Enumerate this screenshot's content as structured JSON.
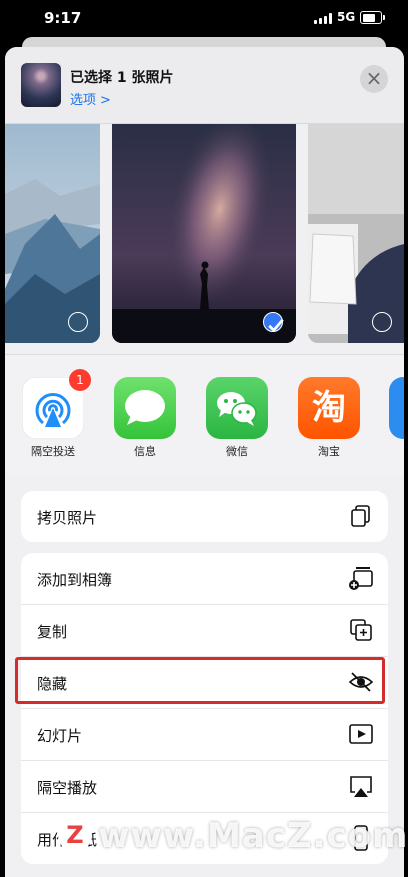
{
  "status_bar": {
    "time": "9:17",
    "network": "5G"
  },
  "header": {
    "title": "已选择 1 张照片",
    "options_label": "选项",
    "options_chevron": ">",
    "close_glyph": "×"
  },
  "apps": [
    {
      "label": "隔空投送",
      "badge": "1",
      "icon": "airdrop-icon"
    },
    {
      "label": "信息",
      "icon": "messages-icon"
    },
    {
      "label": "微信",
      "icon": "wechat-icon"
    },
    {
      "label": "淘宝",
      "icon": "taobao-icon",
      "glyph": "淘"
    }
  ],
  "actions": {
    "group1": [
      {
        "label": "拷贝照片",
        "icon": "copy-photo-icon"
      }
    ],
    "group2": [
      {
        "label": "添加到相簿",
        "icon": "add-to-album-icon"
      },
      {
        "label": "复制",
        "icon": "duplicate-icon"
      },
      {
        "label": "隐藏",
        "icon": "hide-eye-icon"
      },
      {
        "label": "幻灯片",
        "icon": "play-icon"
      },
      {
        "label": "隔空播放",
        "icon": "airplay-icon"
      },
      {
        "label": "用作墙纸",
        "icon": "phone-icon"
      }
    ]
  },
  "watermark": {
    "logo_letter": "Z",
    "text": "www.MacZ.com"
  },
  "colors": {
    "accent": "#3478f6",
    "highlight": "#d52b2b",
    "badge": "#ff3b30"
  }
}
